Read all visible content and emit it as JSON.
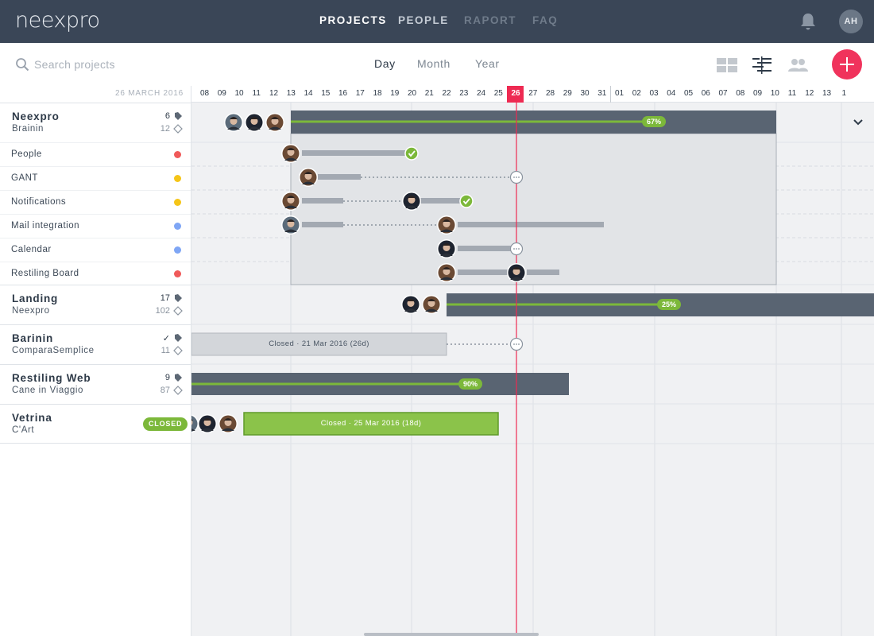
{
  "app": {
    "logo": "neexpro"
  },
  "nav": {
    "links": [
      {
        "label": "PROJECTS",
        "active": true
      },
      {
        "label": "PEOPLE",
        "active": false
      },
      {
        "label": "RAPORT",
        "active": false,
        "muted": true
      },
      {
        "label": "FAQ",
        "active": false,
        "muted": true
      }
    ],
    "user_initials": "AH"
  },
  "toolbar": {
    "search_placeholder": "Search projects",
    "scales": [
      "Day",
      "Month",
      "Year"
    ],
    "active_scale": "Day",
    "view_icons": [
      "grid-view-icon",
      "gantt-view-icon",
      "people-view-icon"
    ]
  },
  "timeline": {
    "current_date_label": "26 MARCH 2016",
    "days": [
      "08",
      "09",
      "10",
      "11",
      "12",
      "13",
      "14",
      "15",
      "16",
      "17",
      "18",
      "19",
      "20",
      "21",
      "22",
      "23",
      "24",
      "25",
      "26",
      "27",
      "28",
      "29",
      "30",
      "31",
      "01",
      "02",
      "03",
      "04",
      "05",
      "06",
      "07",
      "08",
      "09",
      "10",
      "11",
      "12",
      "13",
      "1"
    ],
    "today": "26"
  },
  "projects": [
    {
      "title": "Neexpro",
      "client": "Brainin",
      "count_filled": "6",
      "count_outline": "12",
      "progress": "67%",
      "tasks": [
        {
          "label": "People",
          "color": "#f05a5a"
        },
        {
          "label": "GANT",
          "color": "#f5c518"
        },
        {
          "label": "Notifications",
          "color": "#f5c518"
        },
        {
          "label": "Mail integration",
          "color": "#7fa6f5"
        },
        {
          "label": "Calendar",
          "color": "#7fa6f5"
        },
        {
          "label": "Restiling Board",
          "color": "#f05a5a"
        }
      ]
    },
    {
      "title": "Landing",
      "client": "Neexpro",
      "count_filled": "17",
      "count_outline": "102",
      "progress": "25%"
    },
    {
      "title": "Barinin",
      "client": "ComparaSemplice",
      "count_filled": "✓",
      "count_outline": "11",
      "bar_label": "Closed · 21 Mar 2016 (26d)"
    },
    {
      "title": "Restiling Web",
      "client": "Cane in Viaggio",
      "count_filled": "9",
      "count_outline": "87",
      "progress": "90%"
    },
    {
      "title": "Vetrina",
      "client": "C'Art",
      "badge": "CLOSED",
      "bar_label": "Closed · 25 Mar 2016 (18d)"
    }
  ],
  "colors": {
    "nav_bg": "#3a4657",
    "accent": "#f0335c",
    "today": "#ee2a52",
    "bar_dark": "#596472",
    "progress": "#7cb83a",
    "task_bar": "#a3a9b2"
  }
}
